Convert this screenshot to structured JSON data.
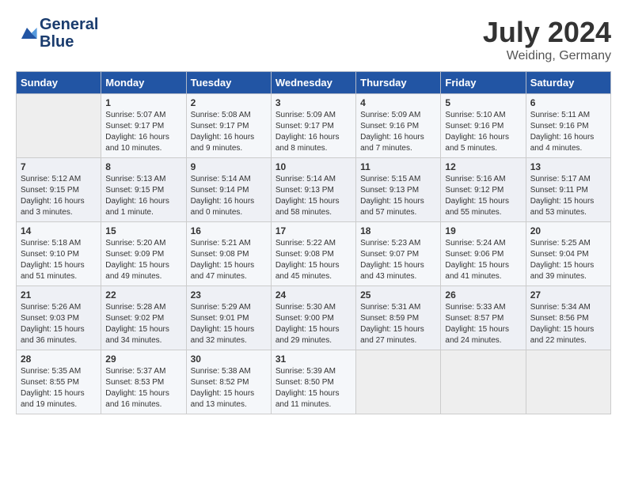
{
  "header": {
    "logo_line1": "General",
    "logo_line2": "Blue",
    "month": "July 2024",
    "location": "Weiding, Germany"
  },
  "days_of_week": [
    "Sunday",
    "Monday",
    "Tuesday",
    "Wednesday",
    "Thursday",
    "Friday",
    "Saturday"
  ],
  "weeks": [
    [
      {
        "day": "",
        "info": ""
      },
      {
        "day": "1",
        "info": "Sunrise: 5:07 AM\nSunset: 9:17 PM\nDaylight: 16 hours\nand 10 minutes."
      },
      {
        "day": "2",
        "info": "Sunrise: 5:08 AM\nSunset: 9:17 PM\nDaylight: 16 hours\nand 9 minutes."
      },
      {
        "day": "3",
        "info": "Sunrise: 5:09 AM\nSunset: 9:17 PM\nDaylight: 16 hours\nand 8 minutes."
      },
      {
        "day": "4",
        "info": "Sunrise: 5:09 AM\nSunset: 9:16 PM\nDaylight: 16 hours\nand 7 minutes."
      },
      {
        "day": "5",
        "info": "Sunrise: 5:10 AM\nSunset: 9:16 PM\nDaylight: 16 hours\nand 5 minutes."
      },
      {
        "day": "6",
        "info": "Sunrise: 5:11 AM\nSunset: 9:16 PM\nDaylight: 16 hours\nand 4 minutes."
      }
    ],
    [
      {
        "day": "7",
        "info": "Sunrise: 5:12 AM\nSunset: 9:15 PM\nDaylight: 16 hours\nand 3 minutes."
      },
      {
        "day": "8",
        "info": "Sunrise: 5:13 AM\nSunset: 9:15 PM\nDaylight: 16 hours\nand 1 minute."
      },
      {
        "day": "9",
        "info": "Sunrise: 5:14 AM\nSunset: 9:14 PM\nDaylight: 16 hours\nand 0 minutes."
      },
      {
        "day": "10",
        "info": "Sunrise: 5:14 AM\nSunset: 9:13 PM\nDaylight: 15 hours\nand 58 minutes."
      },
      {
        "day": "11",
        "info": "Sunrise: 5:15 AM\nSunset: 9:13 PM\nDaylight: 15 hours\nand 57 minutes."
      },
      {
        "day": "12",
        "info": "Sunrise: 5:16 AM\nSunset: 9:12 PM\nDaylight: 15 hours\nand 55 minutes."
      },
      {
        "day": "13",
        "info": "Sunrise: 5:17 AM\nSunset: 9:11 PM\nDaylight: 15 hours\nand 53 minutes."
      }
    ],
    [
      {
        "day": "14",
        "info": "Sunrise: 5:18 AM\nSunset: 9:10 PM\nDaylight: 15 hours\nand 51 minutes."
      },
      {
        "day": "15",
        "info": "Sunrise: 5:20 AM\nSunset: 9:09 PM\nDaylight: 15 hours\nand 49 minutes."
      },
      {
        "day": "16",
        "info": "Sunrise: 5:21 AM\nSunset: 9:08 PM\nDaylight: 15 hours\nand 47 minutes."
      },
      {
        "day": "17",
        "info": "Sunrise: 5:22 AM\nSunset: 9:08 PM\nDaylight: 15 hours\nand 45 minutes."
      },
      {
        "day": "18",
        "info": "Sunrise: 5:23 AM\nSunset: 9:07 PM\nDaylight: 15 hours\nand 43 minutes."
      },
      {
        "day": "19",
        "info": "Sunrise: 5:24 AM\nSunset: 9:06 PM\nDaylight: 15 hours\nand 41 minutes."
      },
      {
        "day": "20",
        "info": "Sunrise: 5:25 AM\nSunset: 9:04 PM\nDaylight: 15 hours\nand 39 minutes."
      }
    ],
    [
      {
        "day": "21",
        "info": "Sunrise: 5:26 AM\nSunset: 9:03 PM\nDaylight: 15 hours\nand 36 minutes."
      },
      {
        "day": "22",
        "info": "Sunrise: 5:28 AM\nSunset: 9:02 PM\nDaylight: 15 hours\nand 34 minutes."
      },
      {
        "day": "23",
        "info": "Sunrise: 5:29 AM\nSunset: 9:01 PM\nDaylight: 15 hours\nand 32 minutes."
      },
      {
        "day": "24",
        "info": "Sunrise: 5:30 AM\nSunset: 9:00 PM\nDaylight: 15 hours\nand 29 minutes."
      },
      {
        "day": "25",
        "info": "Sunrise: 5:31 AM\nSunset: 8:59 PM\nDaylight: 15 hours\nand 27 minutes."
      },
      {
        "day": "26",
        "info": "Sunrise: 5:33 AM\nSunset: 8:57 PM\nDaylight: 15 hours\nand 24 minutes."
      },
      {
        "day": "27",
        "info": "Sunrise: 5:34 AM\nSunset: 8:56 PM\nDaylight: 15 hours\nand 22 minutes."
      }
    ],
    [
      {
        "day": "28",
        "info": "Sunrise: 5:35 AM\nSunset: 8:55 PM\nDaylight: 15 hours\nand 19 minutes."
      },
      {
        "day": "29",
        "info": "Sunrise: 5:37 AM\nSunset: 8:53 PM\nDaylight: 15 hours\nand 16 minutes."
      },
      {
        "day": "30",
        "info": "Sunrise: 5:38 AM\nSunset: 8:52 PM\nDaylight: 15 hours\nand 13 minutes."
      },
      {
        "day": "31",
        "info": "Sunrise: 5:39 AM\nSunset: 8:50 PM\nDaylight: 15 hours\nand 11 minutes."
      },
      {
        "day": "",
        "info": ""
      },
      {
        "day": "",
        "info": ""
      },
      {
        "day": "",
        "info": ""
      }
    ]
  ]
}
